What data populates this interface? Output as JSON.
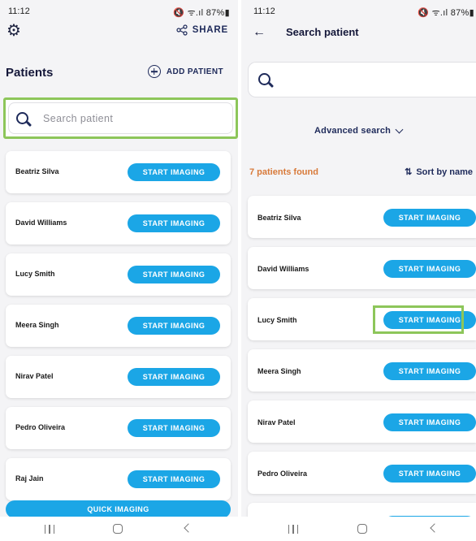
{
  "left": {
    "status_time": "11:12",
    "status_icons": "🔇 ᯤ.ıl 87%▮",
    "share_label": "SHARE",
    "heading": "Patients",
    "add_patient_label": "ADD PATIENT",
    "search_placeholder": "Search patient",
    "patients": [
      {
        "name": "Beatriz Silva",
        "action": "START IMAGING"
      },
      {
        "name": "David Williams",
        "action": "START IMAGING"
      },
      {
        "name": "Lucy Smith",
        "action": "START IMAGING"
      },
      {
        "name": "Meera Singh",
        "action": "START IMAGING"
      },
      {
        "name": "Nirav Patel",
        "action": "START IMAGING"
      },
      {
        "name": "Pedro Oliveira",
        "action": "START IMAGING"
      },
      {
        "name": "Raj Jain",
        "action": "START IMAGING"
      }
    ],
    "quick_imaging_label": "QUICK IMAGING"
  },
  "right": {
    "status_time": "11:12",
    "status_icons": "🔇 ᯤ.ıl 87%▮",
    "title": "Search patient",
    "advanced_search_label": "Advanced search",
    "results_count": "7 patients found",
    "sort_label": "Sort by name",
    "sort_icon": "⇅",
    "patients": [
      {
        "name": "Beatriz Silva",
        "action": "START IMAGING"
      },
      {
        "name": "David Williams",
        "action": "START IMAGING"
      },
      {
        "name": "Lucy Smith",
        "action": "START IMAGING"
      },
      {
        "name": "Meera Singh",
        "action": "START IMAGING"
      },
      {
        "name": "Nirav Patel",
        "action": "START IMAGING"
      },
      {
        "name": "Pedro Oliveira",
        "action": "START IMAGING"
      }
    ]
  },
  "icons": {
    "settings": "gear-icon",
    "share": "share-icon",
    "add": "plus-circle-icon",
    "search": "search-icon",
    "back": "arrow-left-icon",
    "chevron": "chevron-down-icon",
    "sort": "sort-icon"
  },
  "colors": {
    "accent": "#1ba6e6",
    "navy": "#1e2a5a",
    "highlight": "#8dc65a",
    "count": "#d87a3a"
  }
}
